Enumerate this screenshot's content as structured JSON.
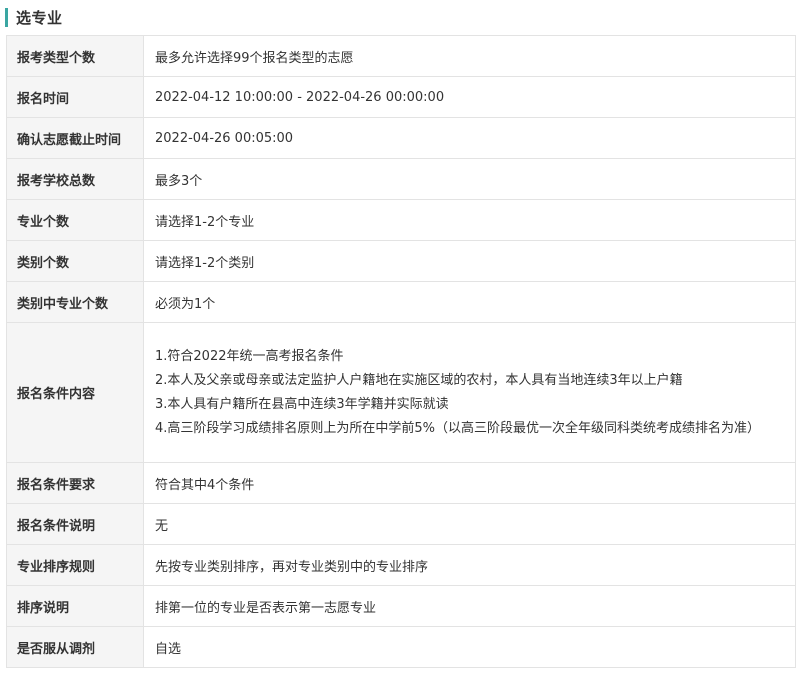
{
  "section": {
    "title": "选专业",
    "accent_color": "#3aa6a2"
  },
  "rows": [
    {
      "label": "报考类型个数",
      "value": "最多允许选择99个报名类型的志愿"
    },
    {
      "label": "报名时间",
      "value": "2022-04-12 10:00:00 - 2022-04-26 00:00:00"
    },
    {
      "label": "确认志愿截止时间",
      "value": "2022-04-26 00:05:00"
    },
    {
      "label": "报考学校总数",
      "value": "最多3个"
    },
    {
      "label": "专业个数",
      "value": "请选择1-2个专业"
    },
    {
      "label": "类别个数",
      "value": "请选择1-2个类别"
    },
    {
      "label": "类别中专业个数",
      "value": "必须为1个"
    },
    {
      "label": "报名条件内容",
      "lines": [
        "1.符合2022年统一高考报名条件",
        "2.本人及父亲或母亲或法定监护人户籍地在实施区域的农村，本人具有当地连续3年以上户籍",
        "3.本人具有户籍所在县高中连续3年学籍并实际就读",
        "4.高三阶段学习成绩排名原则上为所在中学前5%（以高三阶段最优一次全年级同科类统考成绩排名为准）"
      ]
    },
    {
      "label": "报名条件要求",
      "value": "符合其中4个条件"
    },
    {
      "label": "报名条件说明",
      "value": "无"
    },
    {
      "label": "专业排序规则",
      "value": "先按专业类别排序，再对专业类别中的专业排序"
    },
    {
      "label": "排序说明",
      "value": "排第一位的专业是否表示第一志愿专业"
    },
    {
      "label": "是否服从调剂",
      "value": "自选"
    }
  ]
}
